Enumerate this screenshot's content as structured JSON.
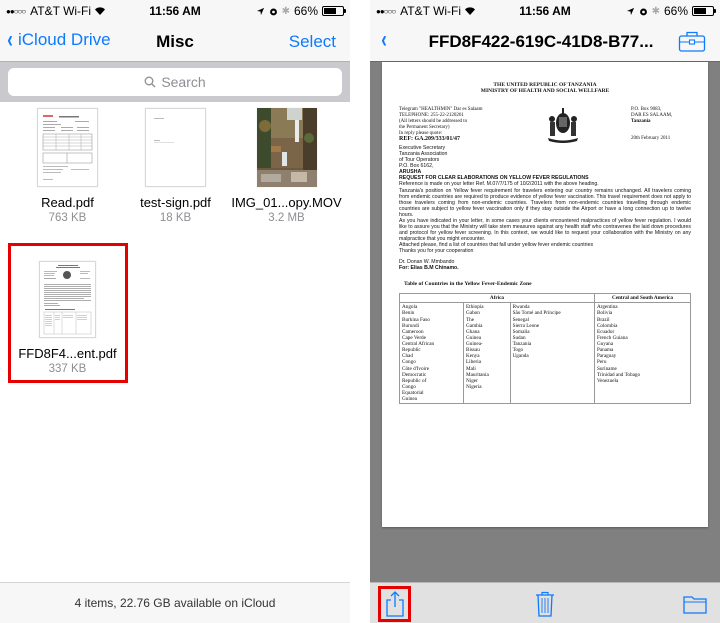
{
  "left_screen": {
    "status_bar": {
      "carrier": "AT&T Wi-Fi",
      "signal_dots": "●●○○○",
      "time": "11:56 AM",
      "battery_percent": "66%",
      "battery_level": 0.66
    },
    "nav": {
      "back_label": "iCloud Drive",
      "title": "Misc",
      "select_label": "Select"
    },
    "search": {
      "placeholder": "Search"
    },
    "files": [
      {
        "name": "Read.pdf",
        "size": "763 KB",
        "thumb": "pdf-form"
      },
      {
        "name": "test-sign.pdf",
        "size": "18 KB",
        "thumb": "pdf-blank"
      },
      {
        "name": "IMG_01...opy.MOV",
        "size": "3.2 MB",
        "thumb": "waterfall-photo"
      },
      {
        "name": "FFD8F4...ent.pdf",
        "size": "337 KB",
        "thumb": "pdf-letter",
        "highlighted": true
      }
    ],
    "footer": "4 items, 22.76 GB available on iCloud",
    "highlight_color": "#e60000"
  },
  "right_screen": {
    "status_bar": {
      "carrier": "AT&T Wi-Fi",
      "signal_dots": "●●○○○",
      "time": "11:56 AM",
      "battery_percent": "66%",
      "battery_level": 0.66
    },
    "nav": {
      "title": "FFD8F422-619C-41D8-B77...",
      "toolbox_icon": "toolbox-icon"
    },
    "document": {
      "header_line1": "THE UNITED REPUBLIC OF TANZANIA",
      "header_line2": "MINISTRY OF HEALTH AND SOCIAL WELLFARE",
      "left_block": [
        "Telegram \"HEALTHMIN\" Dar es Salaam",
        "TELEPHONE: 255-22-2120261",
        "(All letters should be addressed to",
        "  the Permanent Secretary)",
        "In reply please quote:"
      ],
      "ref": "REF: GA.209/333/01/47",
      "right_block": [
        "P.O. Box 9083,",
        "DAR ES SALAAM,",
        "Tanzania"
      ],
      "date": "20th  February 2011",
      "recipient": [
        "Executive Secretary",
        "Tanzania Association",
        "of Tour Operators",
        "P.O. Box 6162,"
      ],
      "city": "ARUSHA",
      "subject": "REQUEST FOR CLEAR ELABORATIONS ON YELLOW FEVER REGULATIONS",
      "paragraphs": [
        "Reference is made on your letter Ref. M.07/7/175 of 10/2/2011 with the above heading.",
        "Tanzania's position on Yellow fever requirement for travelers entering our country remains unchanged. All travelers coming from endemic countries are required to produce evidence of yellow fever vaccination. This travel requirement does not apply to those travelers coming from non-endemic countries. Travelers from non-endemic countries travelling through endemic countries are subject to yellow fever vaccination only if they stay outside the Airport or have a long connection up to twelve hours.",
        "As you have indicated in your letter, in some cases your clients encountered malpractices of yellow fever regulation. I would like to assure you that the Ministry will take stern measures against any health staff who contravenes the laid down procedures and protocol for yellow fever screening. In this context, we would like to request your collaboration with the Ministry on any malpractice that you might encounter.",
        "Attached please, find a list of countries that fall under yellow fever endemic countries",
        "Thanks you for your cooperation"
      ],
      "signer": "Dr. Donan W. Mmbando",
      "for_line": "For: Elias B.M Chinamo.",
      "table_title": "Table of Countries in the Yellow Fever-Endemic Zone",
      "table_headers": [
        "Africa",
        "Central and South America"
      ],
      "table_columns": [
        [
          "Angola",
          "Benin",
          "Burkina Faso",
          "Burundi",
          "Cameroon",
          "Cape Verde",
          "Central African",
          "Republic",
          "Chad",
          "Congo",
          "Côte d'Ivoire",
          "Democratic",
          "Republic of",
          "Congo",
          "Equatorial",
          "Guinea"
        ],
        [
          "Ethiopia",
          "Gabon",
          "The",
          "Gambia",
          "Ghana",
          "Guinea",
          "Guinea-",
          "Bissau",
          "Kenya",
          "Liberia",
          "Mali",
          "Mauritania",
          "Niger",
          "Nigeria"
        ],
        [
          "Rwanda",
          "São Tomé and Principe",
          "Senegal",
          "Sierra Leone",
          "Somalia",
          "Sudan",
          "Tanzania",
          "Togo",
          "Uganda"
        ],
        [
          "Argentina",
          "Bolivia",
          "Brazil",
          "Colombia",
          "Ecuador",
          "French Guiana",
          "Guyana",
          "Panama",
          "Paraguay",
          "Peru",
          "Suriname",
          "Trinidad and Tobago",
          "Venezuela"
        ]
      ]
    },
    "toolbar": {
      "items": [
        "share-icon",
        "trash-icon",
        "folder-icon"
      ],
      "highlighted": "share-icon"
    },
    "accent_color": "#0e7afe"
  }
}
